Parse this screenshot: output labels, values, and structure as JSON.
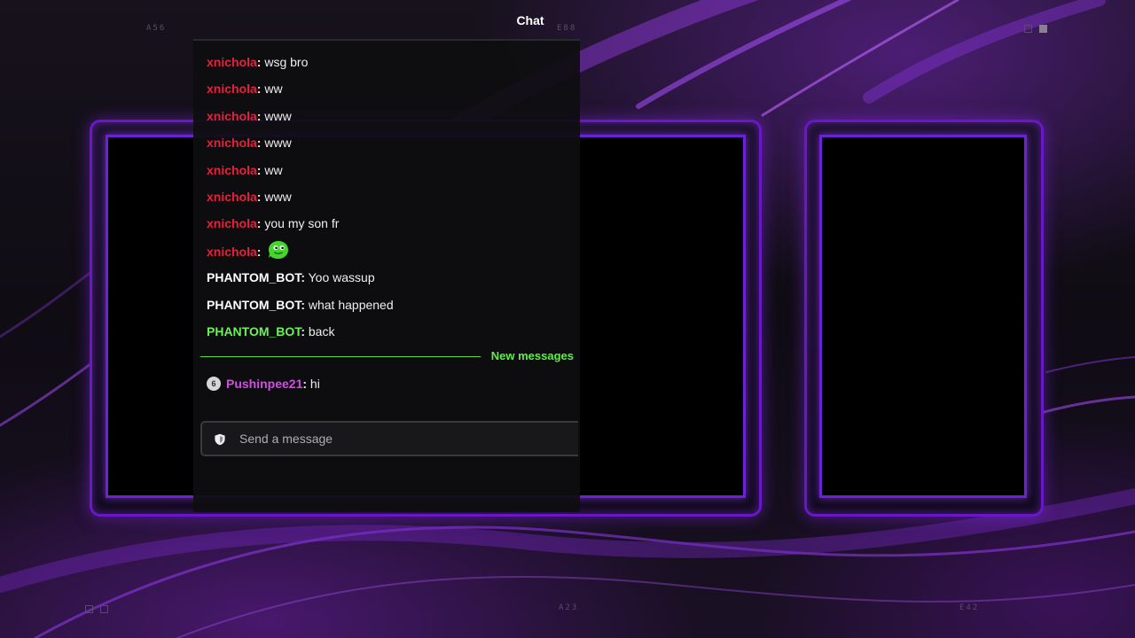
{
  "header": {
    "title": "Chat"
  },
  "corner_labels": {
    "top_left": "A56",
    "top_center": "E88",
    "bottom_center": "A23",
    "bottom_right": "E42"
  },
  "colors": {
    "accent_purple": "#6a17c9",
    "new_messages_green": "#5bf23f",
    "user_red": "#e8203c",
    "user_green": "#6ef05a",
    "user_magenta": "#d64be8"
  },
  "chat": {
    "messages": [
      {
        "user": "xnichola",
        "sep": ":",
        "text": " wsg bro",
        "color": "#e8203c"
      },
      {
        "user": "xnichola",
        "sep": ":",
        "text": " ww",
        "color": "#e8203c"
      },
      {
        "user": "xnichola",
        "sep": ":",
        "text": " www",
        "color": "#e8203c"
      },
      {
        "user": "xnichola",
        "sep": ":",
        "text": " www",
        "color": "#e8203c"
      },
      {
        "user": "xnichola",
        "sep": ":",
        "text": " ww",
        "color": "#e8203c"
      },
      {
        "user": "xnichola",
        "sep": ":",
        "text": " www",
        "color": "#e8203c"
      },
      {
        "user": "xnichola",
        "sep": ":",
        "text": " you my son fr",
        "color": "#e8203c"
      },
      {
        "user": "xnichola",
        "sep": ":",
        "text": "",
        "color": "#e8203c",
        "emote": "green-face-emote"
      },
      {
        "user": "PHANTOM_BOT",
        "sep": ":",
        "text": " Yoo wassup",
        "color": "#ffffff"
      },
      {
        "user": "PHANTOM_BOT",
        "sep": ":",
        "text": " what happened",
        "color": "#ffffff"
      },
      {
        "user": "PHANTOM_BOT",
        "sep": ":",
        "text": " back",
        "color": "#6ef05a"
      }
    ],
    "new_messages_label": "New messages",
    "after_divider": [
      {
        "badge": "6",
        "user": "Pushinpee21",
        "sep": ":",
        "text": " hi",
        "color": "#d64be8"
      }
    ],
    "input_placeholder": "Send a message",
    "input_icon": "shield-icon"
  }
}
